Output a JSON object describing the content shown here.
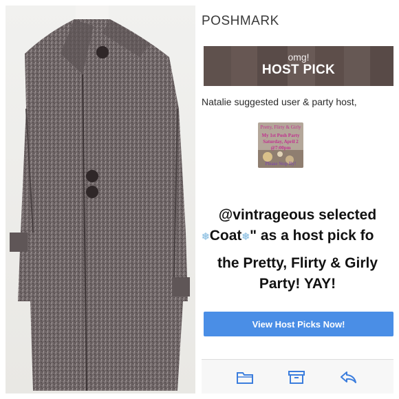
{
  "brand": {
    "name": "POSHMARK"
  },
  "banner": {
    "subtitle": "omg!",
    "title": "HOST PICK"
  },
  "email": {
    "suggested_line": "Natalie suggested user & party host,",
    "party_image_text": [
      "Pretty, Flirty & Girly",
      "My 1st Posh Party",
      "Saturday, April 2",
      "@7:00pm",
      "Please Stop By!"
    ],
    "selected_line_1": "@vintrageous selected",
    "item_name": "Coat",
    "selected_line_2_suffix": "\" as a host pick fo",
    "party_line_1": "the Pretty, Flirty & Girly",
    "party_line_2": "Party! YAY!"
  },
  "cta": {
    "label": "View Host Picks Now!"
  },
  "toolbar": {
    "icons": [
      "folder-icon",
      "archive-icon",
      "reply-icon"
    ]
  },
  "colors": {
    "accent": "#4a8ee6",
    "banner": "#6b5e58",
    "coat": "#6e6566"
  }
}
